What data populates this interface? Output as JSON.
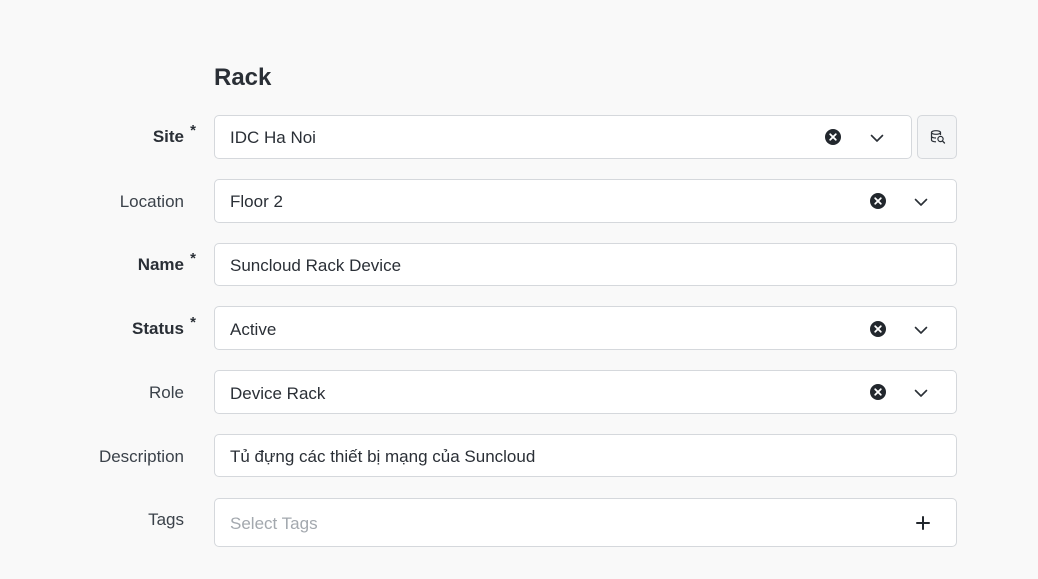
{
  "section": {
    "title": "Rack"
  },
  "fields": {
    "site": {
      "label": "Site",
      "required_mark": "*",
      "value": "IDC Ha Noi"
    },
    "location": {
      "label": "Location",
      "value": "Floor 2"
    },
    "name": {
      "label": "Name",
      "required_mark": "*",
      "value": "Suncloud Rack Device"
    },
    "status": {
      "label": "Status",
      "required_mark": "*",
      "value": "Active"
    },
    "role": {
      "label": "Role",
      "value": "Device Rack"
    },
    "description": {
      "label": "Description",
      "value": "Tủ đựng các thiết bị mạng của Suncloud"
    },
    "tags": {
      "label": "Tags",
      "placeholder": "Select Tags"
    }
  },
  "icons": {
    "clear": "clear-circle-x",
    "dropdown": "chevron-down",
    "lookup": "database-search",
    "add": "plus"
  },
  "colors": {
    "page_background": "#f9f9f9",
    "field_border": "#d5d8dc",
    "text": "#2a2f36",
    "placeholder": "#a3a8ae"
  }
}
